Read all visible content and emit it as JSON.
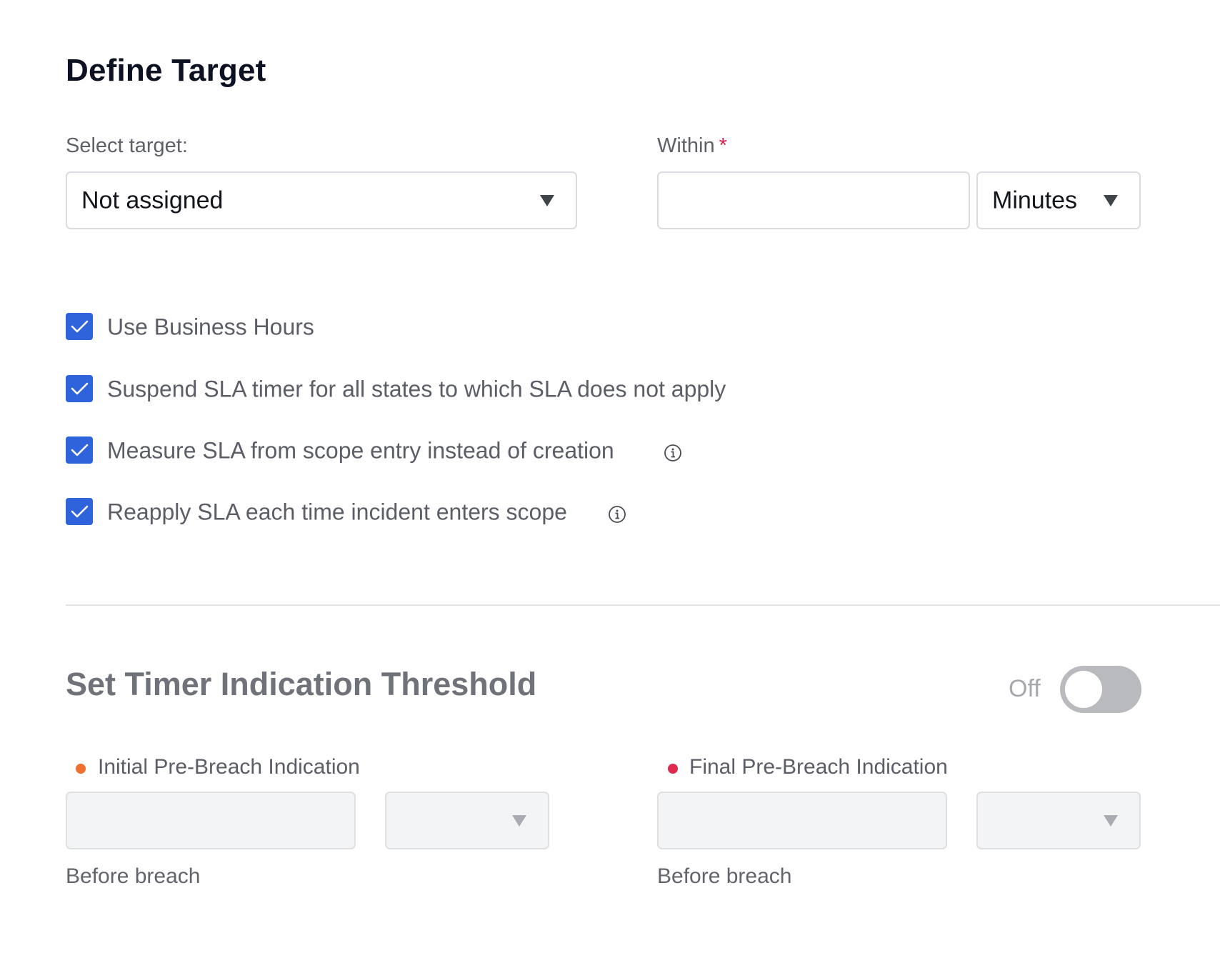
{
  "define_target": {
    "heading": "Define Target",
    "select_target_label": "Select target:",
    "select_target_value": "Not assigned",
    "within_label": "Within",
    "within_required_mark": "*",
    "within_value": "",
    "unit_value": "Minutes"
  },
  "options": [
    {
      "label": "Use Business Hours",
      "checked": true,
      "has_info": false
    },
    {
      "label": "Suspend SLA timer for all states to which SLA does not apply",
      "checked": true,
      "has_info": false
    },
    {
      "label": "Measure SLA from scope entry instead of creation",
      "checked": true,
      "has_info": true
    },
    {
      "label": "Reapply SLA each time incident enters scope",
      "checked": true,
      "has_info": true
    }
  ],
  "threshold": {
    "heading": "Set Timer Indication Threshold",
    "toggle_label": "Off",
    "toggle_on": false,
    "initial": {
      "label": "Initial Pre-Breach Indication",
      "dot_color": "#f07030",
      "value": "",
      "unit": "",
      "hint": "Before breach"
    },
    "final": {
      "label": "Final Pre-Breach Indication",
      "dot_color": "#e0294f",
      "value": "",
      "unit": "",
      "hint": "Before breach"
    }
  },
  "colors": {
    "checkbox": "#2e63dc",
    "required": "#d81b4a",
    "toggle_off": "#b9babd"
  }
}
